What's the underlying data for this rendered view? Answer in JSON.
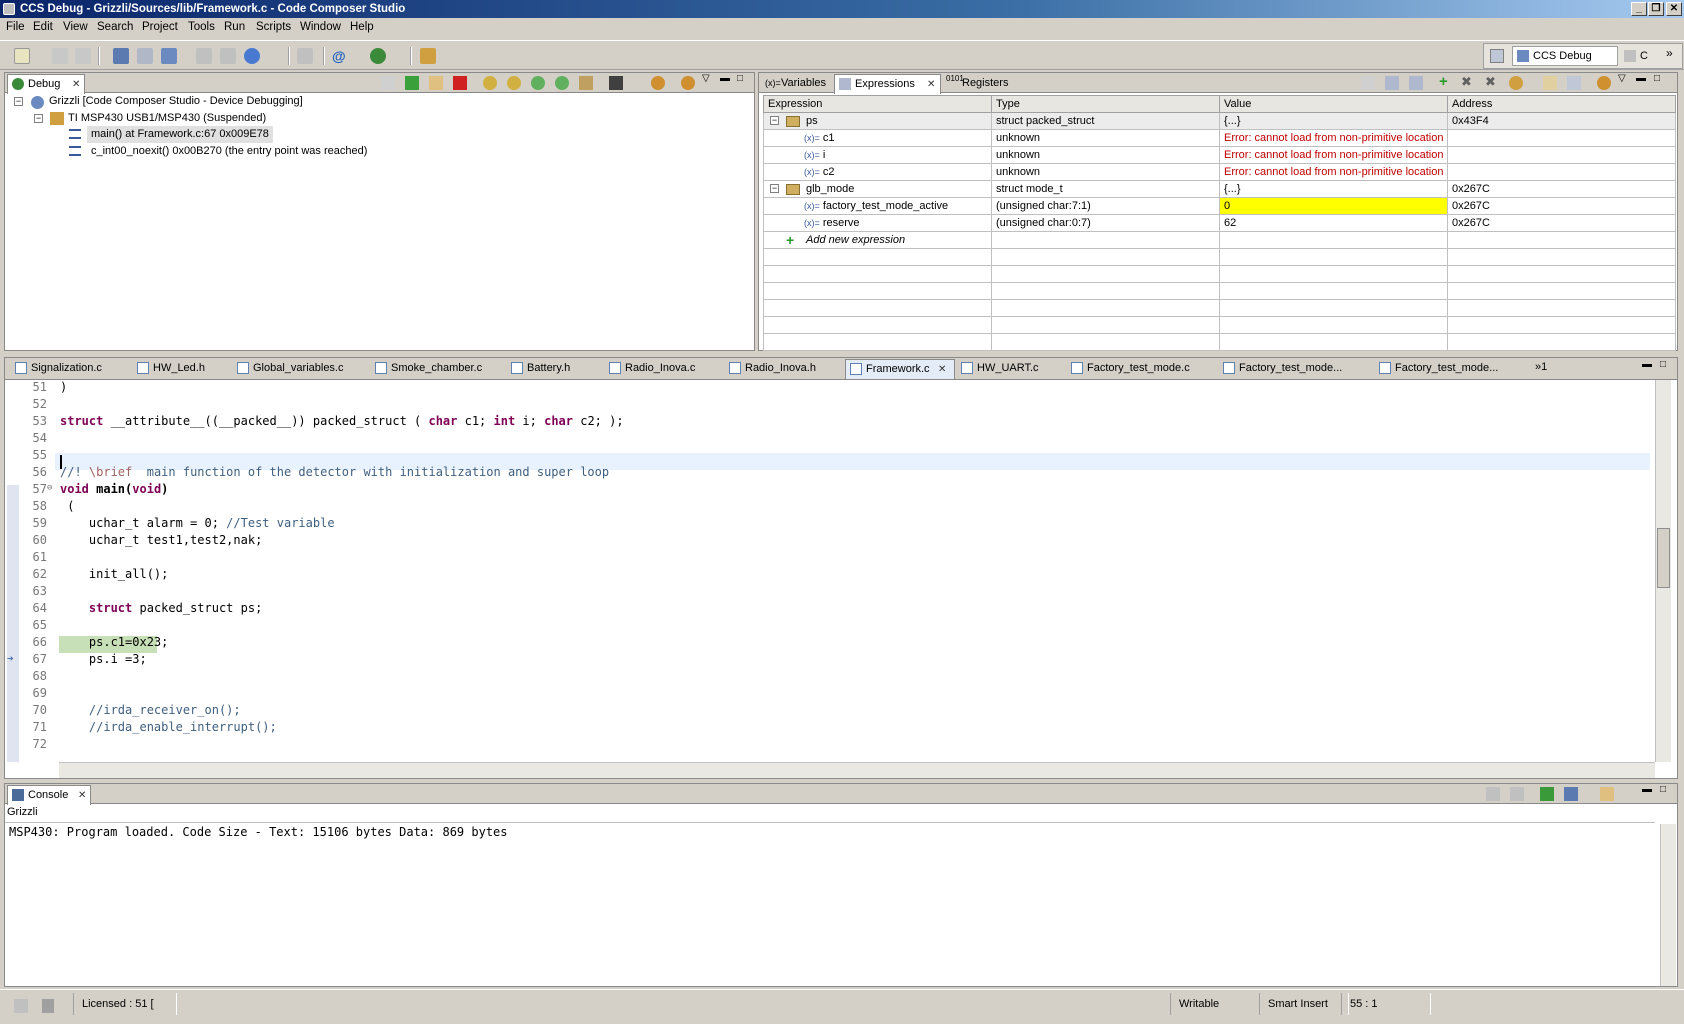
{
  "window": {
    "title": "CCS Debug - Grizzli/Sources/lib/Framework.c - Code Composer Studio",
    "minimize": "_",
    "maximize": "❐",
    "close": "✕"
  },
  "menu": [
    "File",
    "Edit",
    "View",
    "Search",
    "Project",
    "Tools",
    "Run",
    "Scripts",
    "Window",
    "Help"
  ],
  "perspective": {
    "label": "CCS Debug",
    "other": "C",
    "more": "»"
  },
  "debug": {
    "tab": "Debug",
    "tree": [
      {
        "label": "Grizzli [Code Composer Studio - Device Debugging]",
        "expander": "−"
      },
      {
        "label": "TI MSP430 USB1/MSP430 (Suspended)",
        "expander": "−"
      },
      {
        "label": "main() at Framework.c:67 0x009E78"
      },
      {
        "label": "c_int00_noexit() 0x00B270  (the entry point was reached)"
      }
    ]
  },
  "vars": {
    "tabs": [
      "Variables",
      "Expressions",
      "Registers"
    ],
    "headers": [
      "Expression",
      "Type",
      "Value",
      "Address"
    ],
    "rows": [
      {
        "expr": "ps",
        "type": "struct packed_struct",
        "value": "{...}",
        "addr": "0x43F4",
        "expander": "−"
      },
      {
        "expr": "c1",
        "type": "unknown",
        "value": "Error: cannot load from non-primitive location",
        "addr": ""
      },
      {
        "expr": "i",
        "type": "unknown",
        "value": "Error: cannot load from non-primitive location",
        "addr": ""
      },
      {
        "expr": "c2",
        "type": "unknown",
        "value": "Error: cannot load from non-primitive location",
        "addr": ""
      },
      {
        "expr": "glb_mode",
        "type": "struct mode_t",
        "value": "{...}",
        "addr": "0x267C",
        "expander": "−"
      },
      {
        "expr": "factory_test_mode_active",
        "type": "(unsigned char:7:1)",
        "value": "0",
        "addr": "0x267C"
      },
      {
        "expr": "reserve",
        "type": "(unsigned char:0:7)",
        "value": "62",
        "addr": "0x267C"
      }
    ],
    "add_new": "Add new expression",
    "var_prefix": "(x)="
  },
  "editor": {
    "tabs": [
      "Signalization.c",
      "HW_Led.h",
      "Global_variables.c",
      "Smoke_chamber.c",
      "Battery.h",
      "Radio_Inova.c",
      "Radio_Inova.h",
      "Framework.c",
      "HW_UART.c",
      "Factory_test_mode.c",
      "Factory_test_mode...",
      "Factory_test_mode..."
    ],
    "overflow": "»1",
    "line_numbers": [
      "51",
      "52",
      "53",
      "54",
      "55",
      "56",
      "57",
      "58",
      "59",
      "60",
      "61",
      "62",
      "63",
      "64",
      "65",
      "66",
      "67",
      "68",
      "69",
      "70",
      "71",
      "72"
    ],
    "lines": {
      "l51": ")",
      "l53a": "struct",
      "l53b": " __attribute__((__packed__)) packed_struct ( ",
      "l53c": "char",
      "l53d": " c1; ",
      "l53e": "int",
      "l53f": " i; ",
      "l53g": "char",
      "l53h": " c2; );",
      "l56a": "//! ",
      "l56b": "\\brief",
      "l56c": "  main function of the detector with initialization and super loop",
      "l57a": "void",
      "l57b": " main(",
      "l57c": "void",
      "l57d": ")",
      "l58": " (",
      "l59a": "    uchar_t alarm = 0; ",
      "l59b": "//Test variable",
      "l60": "    uchar_t test1,test2,nak;",
      "l62": "    init_all();",
      "l64a": "    ",
      "l64b": "struct",
      "l64c": " packed_struct ps;",
      "l66": "    ps.c1=0x23;",
      "l67": "    ps.i =3;",
      "l70": "    //irda_receiver_on();",
      "l71": "    //irda_enable_interrupt();"
    }
  },
  "console": {
    "tab": "Console",
    "source": "Grizzli",
    "text": "MSP430: Program loaded. Code Size - Text: 15106 bytes  Data: 869 bytes"
  },
  "status": {
    "license": "Licensed : 51 [",
    "writable": "Writable",
    "insert": "Smart Insert",
    "position": "55 : 1"
  },
  "colors": {
    "accent": "#0a246a",
    "error": "#c00000",
    "highlight": "#ffff00",
    "current_line": "#c8e0b8"
  }
}
